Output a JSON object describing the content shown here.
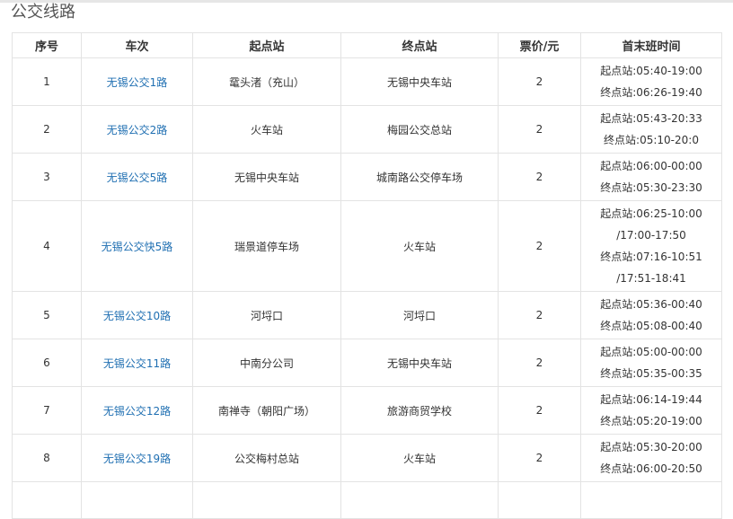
{
  "section_title": "公交线路",
  "columns": [
    "序号",
    "车次",
    "起点站",
    "终点站",
    "票价/元",
    "首末班时间"
  ],
  "rows": [
    {
      "no": "1",
      "route": "无锡公交1路",
      "start": "鼋头渚（充山）",
      "end": "无锡中央车站",
      "fare": "2",
      "schedule": [
        "起点站:05:40-19:00",
        "终点站:06:26-19:40"
      ]
    },
    {
      "no": "2",
      "route": "无锡公交2路",
      "start": "火车站",
      "end": "梅园公交总站",
      "fare": "2",
      "schedule": [
        "起点站:05:43-20:33",
        "终点站:05:10-20:0"
      ]
    },
    {
      "no": "3",
      "route": "无锡公交5路",
      "start": "无锡中央车站",
      "end": "城南路公交停车场",
      "fare": "2",
      "schedule": [
        "起点站:06:00-00:00",
        "终点站:05:30-23:30"
      ]
    },
    {
      "no": "4",
      "route": "无锡公交快5路",
      "start": "瑞景道停车场",
      "end": "火车站",
      "fare": "2",
      "schedule": [
        "起点站:06:25-10:00",
        "/17:00-17:50",
        "终点站:07:16-10:51",
        "/17:51-18:41"
      ]
    },
    {
      "no": "5",
      "route": "无锡公交10路",
      "start": "河埒口",
      "end": "河埒口",
      "fare": "2",
      "schedule": [
        "起点站:05:36-00:40",
        "终点站:05:08-00:40"
      ]
    },
    {
      "no": "6",
      "route": "无锡公交11路",
      "start": "中南分公司",
      "end": "无锡中央车站",
      "fare": "2",
      "schedule": [
        "起点站:05:00-00:00",
        "终点站:05:35-00:35"
      ]
    },
    {
      "no": "7",
      "route": "无锡公交12路",
      "start": "南禅寺（朝阳广场）",
      "end": "旅游商贸学校",
      "fare": "2",
      "schedule": [
        "起点站:06:14-19:44",
        "终点站:05:20-19:00"
      ]
    },
    {
      "no": "8",
      "route": "无锡公交19路",
      "start": "公交梅村总站",
      "end": "火车站",
      "fare": "2",
      "schedule": [
        "起点站:05:30-20:00",
        "终点站:06:00-20:50"
      ]
    }
  ]
}
